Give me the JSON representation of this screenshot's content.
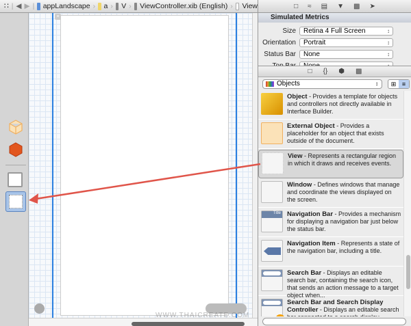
{
  "jumpbar": {
    "crumbs": [
      "appLandscape",
      "a",
      "V",
      "ViewController.xib (English)",
      "View"
    ]
  },
  "inspector": {
    "tabs": [
      "file-icon",
      "quick-help-icon",
      "identity-icon",
      "attributes-icon",
      "size-icon",
      "connections-icon"
    ],
    "section": "Simulated Metrics",
    "rows": [
      {
        "label": "Size",
        "value": "Retina 4 Full Screen"
      },
      {
        "label": "Orientation",
        "value": "Portrait"
      },
      {
        "label": "Status Bar",
        "value": "None"
      },
      {
        "label": "Top Bar",
        "value": "None"
      }
    ]
  },
  "library": {
    "tabs": [
      "file-template-icon",
      "code-snippet-icon",
      "object-icon",
      "media-icon"
    ],
    "filter": "Objects",
    "items": [
      {
        "name": "Object",
        "desc": " - Provides a template for objects and controllers not directly available in Interface Builder."
      },
      {
        "name": "External Object",
        "desc": " - Provides a placeholder for an object that exists outside of the document."
      },
      {
        "name": "View",
        "desc": " - Represents a rectangular region in which it draws and receives events."
      },
      {
        "name": "Window",
        "desc": " - Defines windows that manage and coordinate the views displayed on the screen."
      },
      {
        "name": "Navigation Bar",
        "desc": " - Provides a mechanism for displaying a navigation bar just below the status bar.",
        "badge": "Title"
      },
      {
        "name": "Navigation Item",
        "desc": " - Represents a state of the navigation bar, including a title."
      },
      {
        "name": "Search Bar",
        "desc": " - Displays an editable search bar, containing the search icon, that sends an action message to a target object when..."
      },
      {
        "name": "Search Bar and Search Display Controller",
        "desc": " - Displays an editable search bar connected to a search display..."
      }
    ]
  },
  "watermark": "WWW.THAICREATE.COM",
  "colors": {
    "arrow": "#e0554a",
    "selection": "#2a7fe0"
  }
}
